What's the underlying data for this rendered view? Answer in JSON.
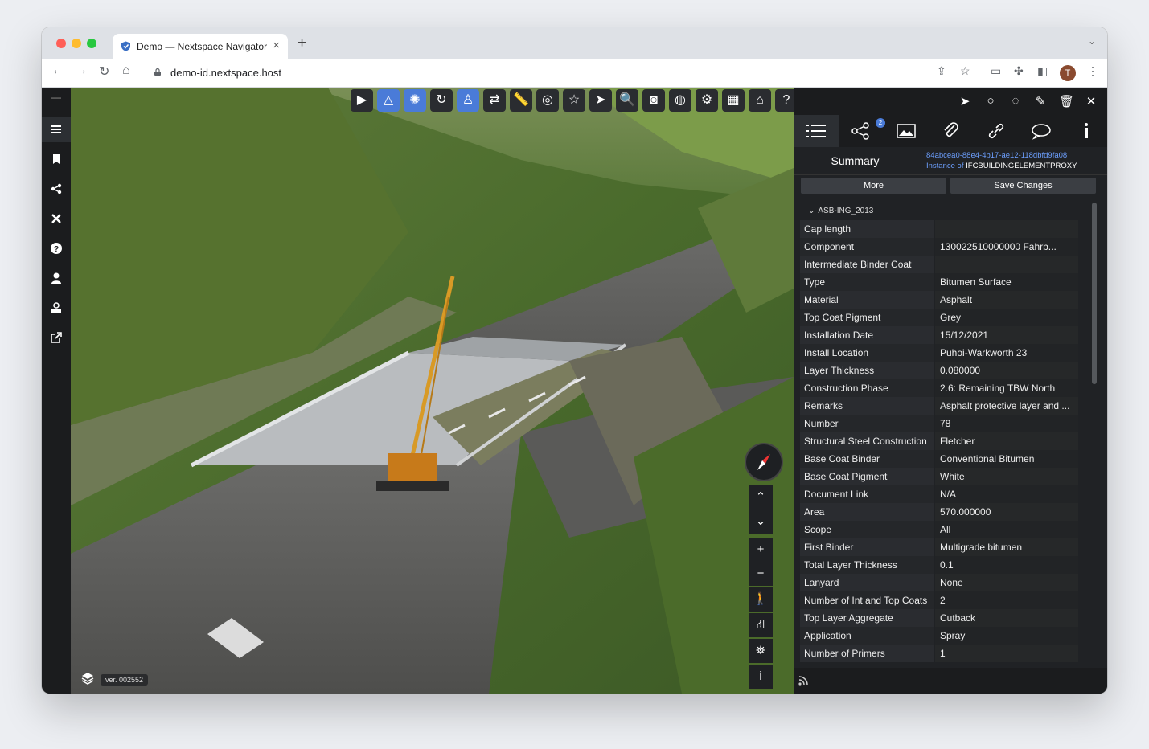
{
  "browser": {
    "tab_title": "Demo — Nextspace Navigator",
    "url": "demo-id.nextspace.host",
    "profile_initial": "T",
    "icons": [
      "back-icon",
      "forward-icon",
      "reload-icon",
      "home-icon",
      "share-icon",
      "star-icon",
      "screen-icon",
      "extensions-icon",
      "sidebar-icon",
      "kebab-icon"
    ]
  },
  "leftbar": {
    "items": [
      "menu-icon",
      "bookmark-icon",
      "share-nodes-icon",
      "tools-icon",
      "help-icon",
      "user-icon",
      "badge-user-icon",
      "external-link-icon"
    ]
  },
  "toolbar": {
    "tools": [
      "play",
      "terrain",
      "shape",
      "rotate",
      "person",
      "swap",
      "measure",
      "target",
      "star",
      "pointer",
      "zoom",
      "camera",
      "globe",
      "settings",
      "grid",
      "home",
      "help"
    ],
    "active": [
      "terrain",
      "shape",
      "person"
    ]
  },
  "viewport": {
    "version": "ver. 002552"
  },
  "panel": {
    "top_icons": [
      "send-icon",
      "circle-icon",
      "hide-icon",
      "brush-icon",
      "trash-icon",
      "close-icon"
    ],
    "tabs": [
      "list",
      "share",
      "images",
      "attachment",
      "link",
      "comments",
      "info"
    ],
    "share_badge": "2",
    "summary_label": "Summary",
    "entity_id": "84abcea0-88e4-4b17-ae12-118dbfd9fa08",
    "instance_prefix": "Instance of",
    "instance_class": "IFCBUILDINGELEMENTPROXY",
    "more_label": "More",
    "save_label": "Save Changes",
    "section": "ASB-ING_2013",
    "properties": [
      {
        "k": "Cap length",
        "v": ""
      },
      {
        "k": "Component",
        "v": "130022510000000     Fahrb..."
      },
      {
        "k": "Intermediate Binder Coat",
        "v": ""
      },
      {
        "k": "Type",
        "v": "Bitumen Surface"
      },
      {
        "k": "Material",
        "v": "Asphalt"
      },
      {
        "k": "Top Coat Pigment",
        "v": "Grey"
      },
      {
        "k": "Installation Date",
        "v": "15/12/2021"
      },
      {
        "k": "Install Location",
        "v": "Puhoi-Warkworth 23"
      },
      {
        "k": "Layer Thickness",
        "v": "0.080000"
      },
      {
        "k": "Construction Phase",
        "v": "2.6: Remaining TBW North"
      },
      {
        "k": "Remarks",
        "v": "Asphalt protective layer and ..."
      },
      {
        "k": "Number",
        "v": "78"
      },
      {
        "k": "Structural Steel Construction",
        "v": "Fletcher"
      },
      {
        "k": "Base Coat Binder",
        "v": "Conventional Bitumen"
      },
      {
        "k": "Base Coat Pigment",
        "v": "White"
      },
      {
        "k": "Document Link",
        "v": "N/A"
      },
      {
        "k": "Area",
        "v": "570.000000"
      },
      {
        "k": "Scope",
        "v": "All"
      },
      {
        "k": "First Binder",
        "v": "Multigrade bitumen"
      },
      {
        "k": "Total Layer Thickness",
        "v": "0.1"
      },
      {
        "k": "Lanyard",
        "v": "None"
      },
      {
        "k": "Number of Int and Top Coats",
        "v": "2"
      },
      {
        "k": "Top Layer Aggregate",
        "v": "Cutback"
      },
      {
        "k": "Application",
        "v": "Spray"
      },
      {
        "k": "Number of Primers",
        "v": "1"
      }
    ]
  },
  "colors": {
    "accent": "#4a7bd8",
    "link": "#6da0ff",
    "panel_bg": "#202225"
  }
}
